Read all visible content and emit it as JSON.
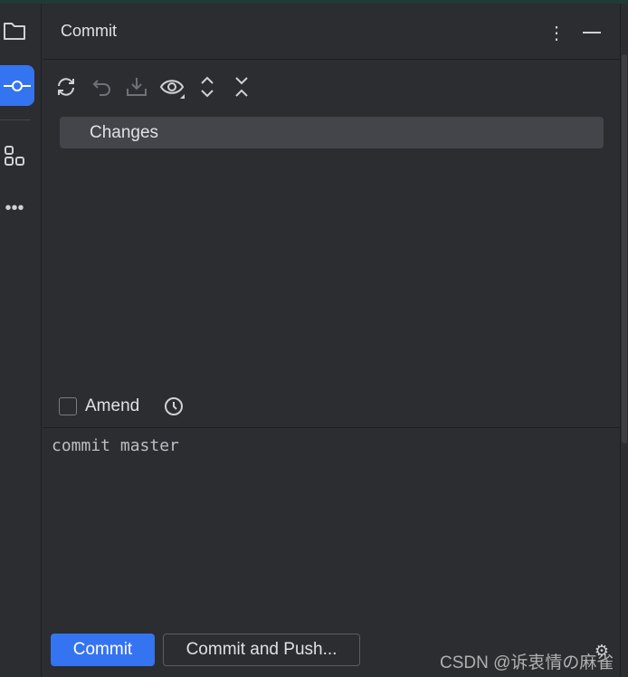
{
  "panel": {
    "title": "Commit"
  },
  "tree": {
    "root": "Changes"
  },
  "amend": {
    "label": "Amend",
    "checked": false
  },
  "message": {
    "value": "commit master"
  },
  "buttons": {
    "commit": "Commit",
    "commit_push": "Commit and Push..."
  },
  "watermark": "CSDN @诉衷情の麻雀",
  "colors": {
    "accent": "#3574f0",
    "background": "#2b2d30"
  }
}
